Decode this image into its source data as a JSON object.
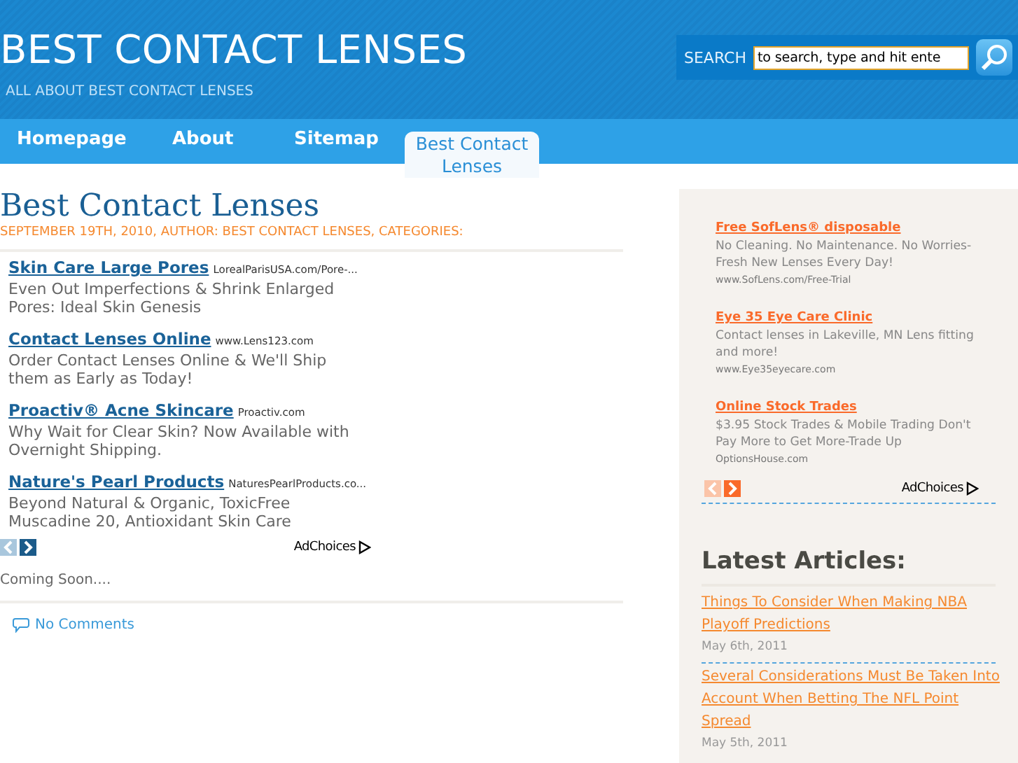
{
  "header": {
    "title": "BEST CONTACT LENSES",
    "tagline": "ALL ABOUT BEST CONTACT LENSES",
    "search": {
      "label": "SEARCH",
      "value": "to search, type and hit ente"
    }
  },
  "nav": [
    {
      "label": "Homepage",
      "selected": false
    },
    {
      "label": "About",
      "selected": false
    },
    {
      "label": "Sitemap",
      "selected": false
    },
    {
      "label": "Best Contact Lenses",
      "selected": true
    }
  ],
  "post": {
    "title": "Best Contact Lenses",
    "meta": "SEPTEMBER 19TH, 2010, AUTHOR: BEST CONTACT LENSES, CATEGORIES:",
    "ads": [
      {
        "title": "Skin Care Large Pores",
        "url": "LorealParisUSA.com/Pore-...",
        "text": "Even Out Imperfections & Shrink Enlarged Pores: Ideal Skin Genesis"
      },
      {
        "title": "Contact Lenses Online",
        "url": "www.Lens123.com",
        "text": "Order Contact Lenses Online & We'll Ship them as Early as Today!"
      },
      {
        "title": "Proactiv® Acne Skincare",
        "url": "Proactiv.com",
        "text": "Why Wait for Clear Skin? Now Available with Overnight Shipping."
      },
      {
        "title": "Nature's Pearl Products",
        "url": "NaturesPearlProducts.co...",
        "text": "Beyond Natural & Organic, ToxicFree Muscadine 20, Antioxidant Skin Care"
      }
    ],
    "adchoices": "AdChoices",
    "body": "Coming Soon....",
    "comments": "No Comments"
  },
  "sidebar": {
    "ads": [
      {
        "title": "Free SofLens® disposable",
        "text": "No Cleaning. No Maintenance. No Worries-Fresh New Lenses Every Day!",
        "url": "www.SofLens.com/Free-Trial"
      },
      {
        "title": "Eye 35 Eye Care Clinic",
        "text": "Contact lenses in Lakeville, MN Lens fitting and more!",
        "url": "www.Eye35eyecare.com"
      },
      {
        "title": "Online Stock Trades",
        "text": "$3.95 Stock Trades & Mobile Trading Don't Pay More to Get More-Trade Up",
        "url": "OptionsHouse.com"
      }
    ],
    "adchoices": "AdChoices",
    "heading": "Latest Articles:",
    "articles": [
      {
        "title": "Things To Consider When Making NBA Playoff Predictions",
        "date": "May 6th, 2011"
      },
      {
        "title": "Several Considerations Must Be Taken Into Account When Betting The NFL Point Spread",
        "date": "May 5th, 2011"
      }
    ]
  }
}
